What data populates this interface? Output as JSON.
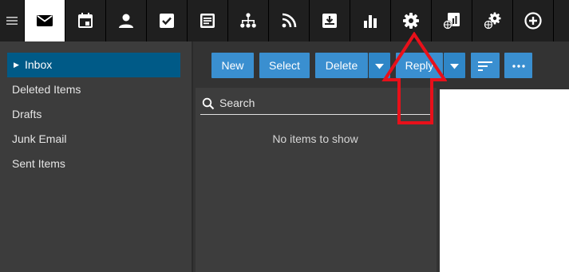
{
  "nav": {
    "items": [
      {
        "name": "mail",
        "icon": "envelope-icon",
        "active": true
      },
      {
        "name": "calendar",
        "icon": "calendar-icon"
      },
      {
        "name": "contacts",
        "icon": "person-icon"
      },
      {
        "name": "tasks",
        "icon": "checkbox-icon"
      },
      {
        "name": "notes",
        "icon": "note-icon"
      },
      {
        "name": "organization",
        "icon": "org-chart-icon"
      },
      {
        "name": "feeds",
        "icon": "rss-icon"
      },
      {
        "name": "archive",
        "icon": "download-tray-icon"
      },
      {
        "name": "reports",
        "icon": "bar-chart-icon"
      },
      {
        "name": "settings",
        "icon": "gear-icon"
      },
      {
        "name": "domain-reports",
        "icon": "globe-report-icon"
      },
      {
        "name": "domain-settings",
        "icon": "globe-gear-icon"
      },
      {
        "name": "add",
        "icon": "plus-circle-icon"
      }
    ]
  },
  "folders": [
    {
      "label": "Inbox",
      "selected": true
    },
    {
      "label": "Deleted Items"
    },
    {
      "label": "Drafts"
    },
    {
      "label": "Junk Email"
    },
    {
      "label": "Sent Items"
    }
  ],
  "toolbar": {
    "new_label": "New",
    "select_label": "Select",
    "delete_label": "Delete",
    "reply_label": "Reply"
  },
  "list": {
    "search_label": "Search",
    "empty_text": "No items to show"
  },
  "colors": {
    "accent": "#3a8fd0",
    "selected_folder": "#005a87",
    "annotation_arrow": "#e8101a"
  }
}
